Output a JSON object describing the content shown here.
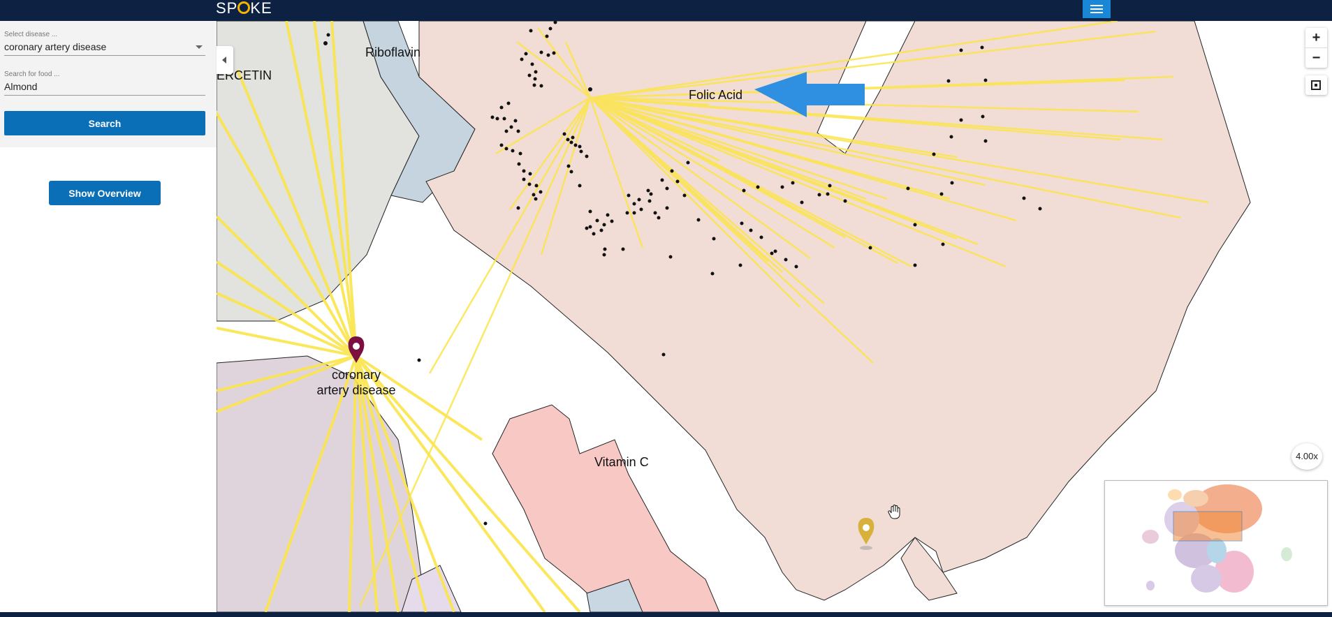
{
  "header": {
    "logo_text_left": "SP",
    "logo_text_right": "KE"
  },
  "sidebar": {
    "disease": {
      "label": "Select disease ...",
      "value": "coronary artery disease"
    },
    "food": {
      "label": "Search for food ...",
      "value": "Almond"
    },
    "search_label": "Search",
    "overview_label": "Show Overview"
  },
  "map": {
    "labels": {
      "folic_acid": "Folic Acid",
      "riboflavin": "Riboflavin",
      "quercetin": "ERCETIN",
      "vitamin_c": "Vitamin C",
      "disease_line1": "coronary",
      "disease_line2": "artery disease"
    },
    "zoom_in": "+",
    "zoom_out": "−",
    "zoom_level": "4.00x"
  },
  "colors": {
    "topbar": "#0d2143",
    "button": "#0b6fb8",
    "edge": "#fbe54b",
    "disease_marker": "#7b1040",
    "food_marker": "#d8b13a",
    "arrow": "#2f8fe0"
  }
}
